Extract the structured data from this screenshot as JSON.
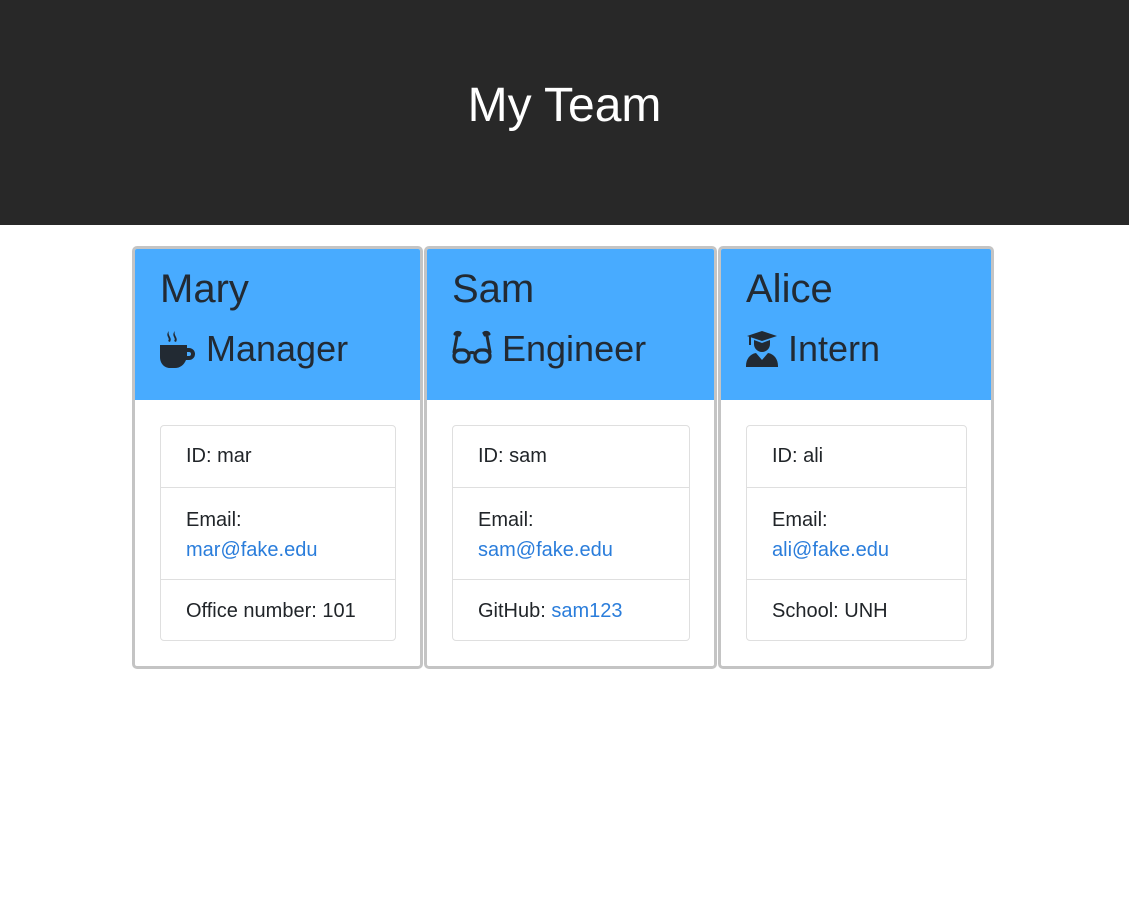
{
  "header": {
    "title": "My Team"
  },
  "colors": {
    "header_bg": "#282828",
    "card_head": "#48abff",
    "link": "#2a7ddb"
  },
  "cards": [
    {
      "name": "Mary",
      "role": "Manager",
      "icon": "coffee-mug-icon",
      "id_text": "ID: mar",
      "email_label": "Email:",
      "email": "mar@fake.edu",
      "extra_label": "Office number: 101",
      "extra_link": ""
    },
    {
      "name": "Sam",
      "role": "Engineer",
      "icon": "glasses-icon",
      "id_text": "ID: sam",
      "email_label": "Email:",
      "email": "sam@fake.edu",
      "extra_label": "GitHub: ",
      "extra_link": "sam123"
    },
    {
      "name": "Alice",
      "role": "Intern",
      "icon": "graduate-icon",
      "id_text": "ID: ali",
      "email_label": "Email:",
      "email": "ali@fake.edu",
      "extra_label": "School: UNH",
      "extra_link": ""
    }
  ]
}
